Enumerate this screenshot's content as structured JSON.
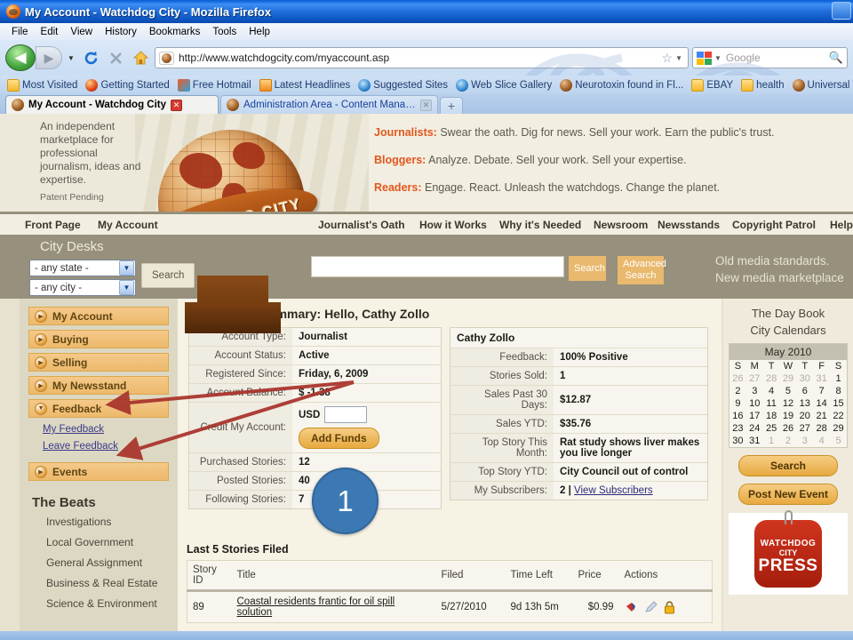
{
  "browser": {
    "window_title": "My Account - Watchdog City - Mozilla Firefox",
    "menu": [
      "File",
      "Edit",
      "View",
      "History",
      "Bookmarks",
      "Tools",
      "Help"
    ],
    "url": "http://www.watchdogcity.com/myaccount.asp",
    "search_placeholder": "Google",
    "bookmarks": [
      {
        "label": "Most Visited",
        "icon": "folder-icon"
      },
      {
        "label": "Getting Started",
        "icon": "firefox-icon"
      },
      {
        "label": "Free Hotmail",
        "icon": "windows-icon"
      },
      {
        "label": "Latest Headlines",
        "icon": "rss-icon"
      },
      {
        "label": "Suggested Sites",
        "icon": "ie-icon"
      },
      {
        "label": "Web Slice Gallery",
        "icon": "ie-icon"
      },
      {
        "label": "Neurotoxin found in Fl...",
        "icon": "watchdog-icon"
      },
      {
        "label": "EBAY",
        "icon": "folder-icon"
      },
      {
        "label": "health",
        "icon": "folder-icon"
      },
      {
        "label": "Universal Terms of",
        "icon": "watchdog-icon"
      }
    ],
    "tabs": [
      {
        "label": "My Account - Watchdog City",
        "active": true
      },
      {
        "label": "Administration Area - Content Manage...",
        "active": false
      }
    ],
    "new_tab_label": "+"
  },
  "masthead": {
    "tagline": "An independent marketplace for professional journalism, ideas and expertise.",
    "patent": "Patent Pending",
    "logo_text": "WATCHDOG CITY",
    "audience_lines": [
      {
        "who": "Journalists:",
        "text": "Swear the oath. Dig for news. Sell your work. Earn the public's trust."
      },
      {
        "who": "Bloggers:",
        "text": "Analyze. Debate. Sell your work. Sell your expertise."
      },
      {
        "who": "Readers:",
        "text": "Engage. React. Unleash the watchdogs. Change the planet."
      }
    ]
  },
  "sitenav": [
    "Front Page",
    "My Account",
    "Journalist's Oath",
    "How it Works",
    "Why it's Needed",
    "Newsroom",
    "Newsstands",
    "Copyright Patrol",
    "Help"
  ],
  "search_strip": {
    "city_desks_title": "City Desks",
    "state_select": "- any state -",
    "city_select": "- any city -",
    "desk_search_label": "Search",
    "main_search_value": "",
    "search_label": "Search",
    "advanced_search_label": "Advanced Search",
    "slogan_line1": "Old media standards.",
    "slogan_line2": "New media marketplace"
  },
  "sidebar": {
    "items": [
      {
        "label": "My Account",
        "state": "collapsed"
      },
      {
        "label": "Buying",
        "state": "collapsed"
      },
      {
        "label": "Selling",
        "state": "collapsed"
      },
      {
        "label": "My Newsstand",
        "state": "collapsed"
      },
      {
        "label": "Feedback",
        "state": "expanded"
      }
    ],
    "sublinks": [
      "My Feedback",
      "Leave Feedback"
    ],
    "events_label": "Events",
    "beats_title": "The Beats",
    "beats": [
      "Investigations",
      "Local Government",
      "General Assignment",
      "Business & Real Estate",
      "Science & Environment"
    ]
  },
  "main": {
    "title": "My Account Summary: Hello, Cathy Zollo",
    "account_rows": [
      {
        "key": "Account Type:",
        "value": "Journalist"
      },
      {
        "key": "Account Status:",
        "value": "Active"
      },
      {
        "key": "Registered Since:",
        "value": "Friday,             6, 2009"
      },
      {
        "key": "Account Balance:",
        "value": "$ -1.38",
        "color": "#e01b1b"
      }
    ],
    "credit_label": "Credit My Account:",
    "usd_label": "USD",
    "usd_value": "",
    "add_funds_label": "Add Funds",
    "counts": [
      {
        "key": "Purchased Stories:",
        "value": "12"
      },
      {
        "key": "Posted Stories:",
        "value": "40"
      },
      {
        "key": "Following Stories:",
        "value": "7"
      }
    ],
    "profile_name": "Cathy Zollo",
    "profile_rows": [
      {
        "key": "Feedback:",
        "value": "100% Positive"
      },
      {
        "key": "Stories Sold:",
        "value": "1"
      },
      {
        "key": "Sales Past 30 Days:",
        "value": "$12.87"
      },
      {
        "key": "Sales YTD:",
        "value": "$35.76"
      },
      {
        "key": "Top Story This Month:",
        "value": "Rat study shows liver makes you live longer"
      },
      {
        "key": "Top Story YTD:",
        "value": "City Council out of control"
      }
    ],
    "subscribers_key": "My Subscribers:",
    "subscribers_count": "2",
    "subscribers_sep": "|",
    "subscribers_link": "View Subscribers",
    "stories_title": "Last 5 Stories Filed",
    "stories_headers": [
      "Story ID",
      "Title",
      "Filed",
      "Time Left",
      "Price",
      "Actions"
    ],
    "stories": [
      {
        "id": "89",
        "title": "Coastal residents frantic for oil spill solution",
        "filed": "5/27/2010",
        "time_left": "9d 13h 5m",
        "price": "$0.99"
      }
    ]
  },
  "rightcol": {
    "heading1": "The Day Book",
    "heading2": "City Calendars",
    "calendar": {
      "month": "May 2010",
      "daynames": [
        "S",
        "M",
        "T",
        "W",
        "T",
        "F",
        "S"
      ],
      "weeks": [
        [
          {
            "d": "26",
            "mute": true
          },
          {
            "d": "27",
            "mute": true
          },
          {
            "d": "28",
            "mute": true
          },
          {
            "d": "29",
            "mute": true
          },
          {
            "d": "30",
            "mute": true
          },
          {
            "d": "31",
            "mute": true
          },
          {
            "d": "1"
          }
        ],
        [
          {
            "d": "2"
          },
          {
            "d": "3"
          },
          {
            "d": "4"
          },
          {
            "d": "5"
          },
          {
            "d": "6"
          },
          {
            "d": "7"
          },
          {
            "d": "8"
          }
        ],
        [
          {
            "d": "9"
          },
          {
            "d": "10"
          },
          {
            "d": "11"
          },
          {
            "d": "12"
          },
          {
            "d": "13"
          },
          {
            "d": "14"
          },
          {
            "d": "15"
          }
        ],
        [
          {
            "d": "16"
          },
          {
            "d": "17"
          },
          {
            "d": "18"
          },
          {
            "d": "19"
          },
          {
            "d": "20"
          },
          {
            "d": "21"
          },
          {
            "d": "22"
          }
        ],
        [
          {
            "d": "23"
          },
          {
            "d": "24"
          },
          {
            "d": "25"
          },
          {
            "d": "26"
          },
          {
            "d": "27"
          },
          {
            "d": "28"
          },
          {
            "d": "29"
          }
        ],
        [
          {
            "d": "30"
          },
          {
            "d": "31"
          },
          {
            "d": "1",
            "mute": true
          },
          {
            "d": "2",
            "mute": true
          },
          {
            "d": "3",
            "mute": true
          },
          {
            "d": "4",
            "mute": true
          },
          {
            "d": "5",
            "mute": true
          }
        ]
      ]
    },
    "search_label": "Search",
    "post_event_label": "Post New Event",
    "press_line1": "WATCHDOG",
    "press_line2": "CITY",
    "press_line3": "PRESS"
  },
  "annotations": {
    "circle1": "1"
  },
  "colors": {
    "accent_orange": "#e2571e",
    "balance_red": "#e01b1b",
    "annotation_blue": "#3c79b4",
    "arrow_red": "#a8312a",
    "sidebar_tan": "#edb96b"
  }
}
